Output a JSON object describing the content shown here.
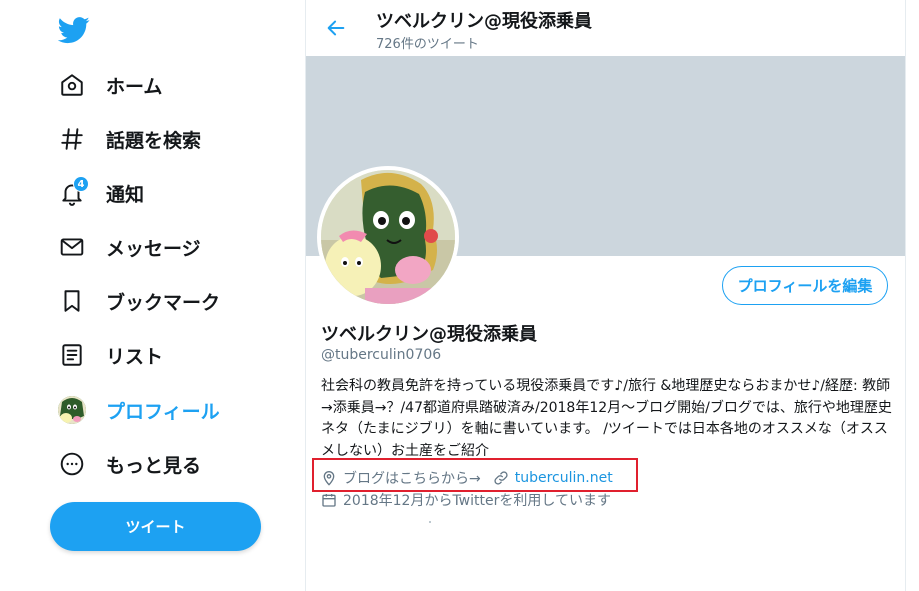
{
  "nav": {
    "items": [
      {
        "label": "ホーム",
        "icon": "home-icon"
      },
      {
        "label": "話題を検索",
        "icon": "hashtag-icon"
      },
      {
        "label": "通知",
        "icon": "bell-icon",
        "badge": "4"
      },
      {
        "label": "メッセージ",
        "icon": "envelope-icon"
      },
      {
        "label": "ブックマーク",
        "icon": "bookmark-icon"
      },
      {
        "label": "リスト",
        "icon": "list-icon"
      },
      {
        "label": "プロフィール",
        "icon": "avatar",
        "active": true
      },
      {
        "label": "もっと見る",
        "icon": "more-icon"
      }
    ],
    "tweet_button": "ツイート"
  },
  "header": {
    "title": "ツベルクリン@現役添乗員",
    "tweet_count": "726件のツイート"
  },
  "profile": {
    "edit_button": "プロフィールを編集",
    "name": "ツベルクリン@現役添乗員",
    "handle": "@tuberculin0706",
    "bio": "社会科の教員免許を持っている現役添乗員です♪/旅行 &地理歴史ならおまかせ♪/経歴: 教師→添乗員→？/47都道府県踏破済み/2018年12月〜ブログ開始/ブログでは、旅行や地理歴史ネタ（たまにジブリ）を軸に書いています。 /ツイートでは日本各地のオススメな（オススメしない）お土産をご紹介",
    "location": "ブログはこちらから→",
    "website": "tuberculin.net",
    "joined": "2018年12月からTwitterを利用しています"
  },
  "colors": {
    "accent": "#1da1f2",
    "banner": "#ccd6dd",
    "highlight": "#e0202e"
  }
}
